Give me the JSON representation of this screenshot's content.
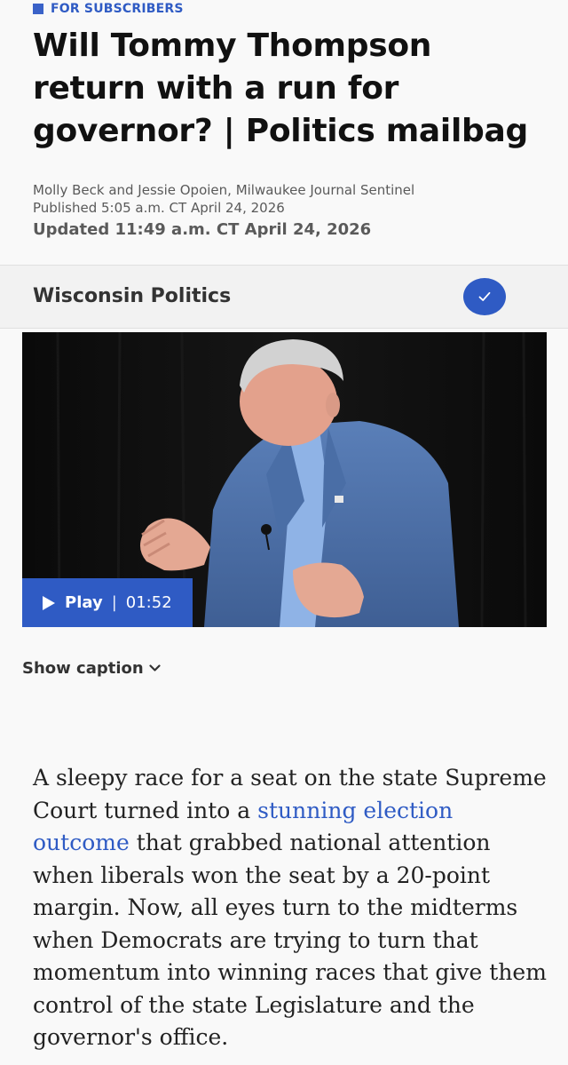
{
  "article": {
    "subscriber_label": "FOR SUBSCRIBERS",
    "headline": "Will Tommy Thompson return with a run for governor? | Politics mailbag",
    "byline": "Molly Beck and Jessie Opoien, Milwaukee Journal Sentinel",
    "published": "Published 5:05 a.m. CT April 24, 2026",
    "updated": "Updated 11:49 a.m. CT April 24, 2026"
  },
  "topic": {
    "title": "Wisconsin Politics",
    "follow_icon": "checkmark-icon"
  },
  "video": {
    "play_label": "Play",
    "separator": "|",
    "duration": "01:52"
  },
  "caption": {
    "toggle_label": "Show caption"
  },
  "body": {
    "text_before_link": "A sleepy race for a seat on the state Supreme Court turned into a ",
    "link_text": "stunning election outcome",
    "text_after_link": " that grabbed national attention when liberals won the seat by a 20-point margin. Now, all eyes turn to the midterms when Democrats are trying to turn that momentum into winning races that give them control of the state Legislature and the governor's office."
  },
  "colors": {
    "accent": "#2f5bc4",
    "background": "#f9f9f9"
  }
}
